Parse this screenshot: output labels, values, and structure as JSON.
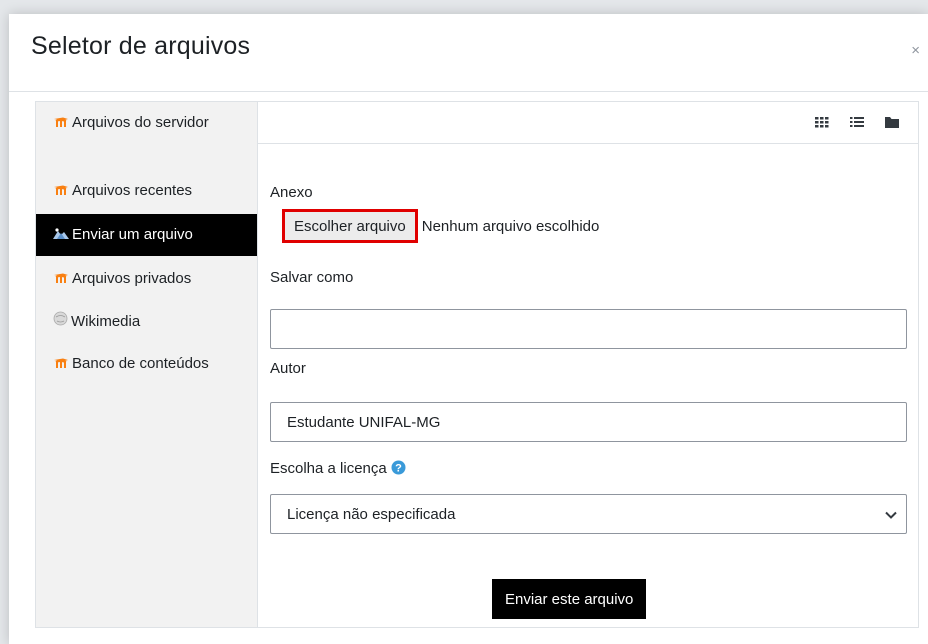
{
  "dialog": {
    "title": "Seletor de arquivos",
    "close": "×"
  },
  "sidebar": {
    "items": [
      {
        "label": "Arquivos do servidor",
        "icon": "moodle-icon"
      },
      {
        "label": "Arquivos recentes",
        "icon": "moodle-icon"
      },
      {
        "label": "Enviar um arquivo",
        "icon": "upload-icon",
        "active": true
      },
      {
        "label": "Arquivos privados",
        "icon": "moodle-icon"
      },
      {
        "label": "Wikimedia",
        "icon": "wikimedia-icon"
      },
      {
        "label": "Banco de conteúdos",
        "icon": "moodle-icon"
      }
    ]
  },
  "toolbar": {
    "views": [
      "grid-view-icon",
      "list-view-icon",
      "folder-view-icon"
    ]
  },
  "form": {
    "attachment_label": "Anexo",
    "choose_file_button": "Escolher arquivo",
    "no_file_text": "Nenhum arquivo escolhido",
    "save_as_label": "Salvar como",
    "save_as_value": "",
    "author_label": "Autor",
    "author_value": "Estudante UNIFAL-MG",
    "license_label": "Escolha a licença",
    "license_value": "Licença não especificada",
    "submit_button": "Enviar este arquivo"
  },
  "colors": {
    "accent": "#000000",
    "highlight_border": "#e00000",
    "moodle_orange": "#f98012",
    "help_blue": "#3a9ad9"
  }
}
